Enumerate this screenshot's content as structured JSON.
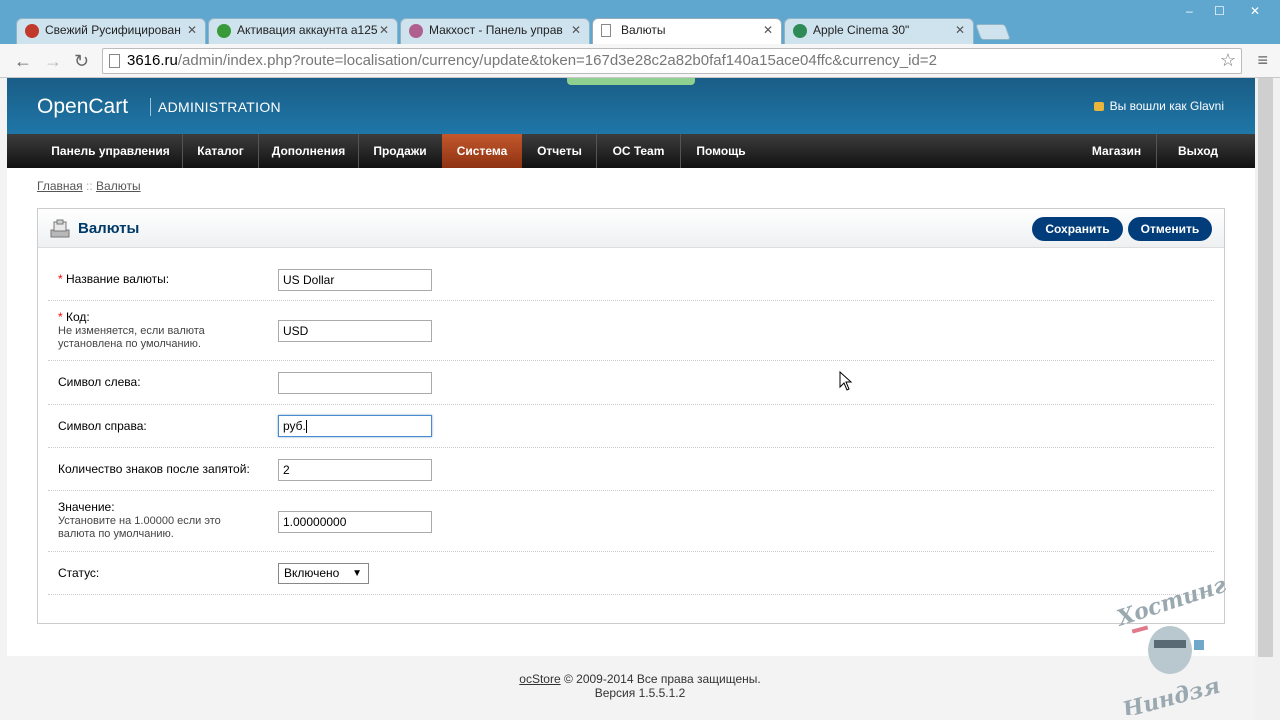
{
  "browser": {
    "tabs": [
      {
        "title": "Свежий Русифицирован",
        "icon_color": "#c0392b",
        "active": false
      },
      {
        "title": "Активация аккаунта a125",
        "icon_color": "#3a9a3a",
        "active": false
      },
      {
        "title": "Макхост - Панель управ",
        "icon_color": "#b06090",
        "active": false
      },
      {
        "title": "Валюты",
        "icon_color": "#ffffff",
        "active": true
      },
      {
        "title": "Apple Cinema 30\"",
        "icon_color": "#2e8b57",
        "active": false
      }
    ],
    "close_glyph": "✕",
    "window_controls": [
      "–",
      "☐",
      "✕"
    ],
    "url_host": "3616.ru",
    "url_path": "/admin/index.php?route=localisation/currency/update&token=167d3e28c2a82b0faf140a15ace04ffc&currency_id=2",
    "back_glyph": "←",
    "forward_glyph": "→",
    "reload_glyph": "↻",
    "star_glyph": "☆",
    "menu_glyph": "≡"
  },
  "header": {
    "logo": "OpenCart",
    "subtitle": "ADMINISTRATION",
    "login_text": "Вы вошли как Glavni"
  },
  "menu": {
    "items": [
      "Панель управления",
      "Каталог",
      "Дополнения",
      "Продажи",
      "Система",
      "Отчеты",
      "OC Team",
      "Помощь"
    ],
    "right_items": [
      "Магазин",
      "Выход"
    ],
    "active": "Система"
  },
  "breadcrumb": {
    "home": "Главная",
    "separator": "::",
    "current": "Валюты"
  },
  "panel": {
    "title": "Валюты",
    "save_label": "Сохранить",
    "cancel_label": "Отменить"
  },
  "form": {
    "required_mark": "*",
    "name_label": "Название валюты:",
    "name_value": "US Dollar",
    "code_label": "Код:",
    "code_help": "Не изменяется, если валюта установлена по умолчанию.",
    "code_value": "USD",
    "symbol_left_label": "Символ слева:",
    "symbol_left_value": "",
    "symbol_right_label": "Символ справа:",
    "symbol_right_value": "руб.",
    "decimal_label": "Количество знаков после запятой:",
    "decimal_value": "2",
    "value_label": "Значение:",
    "value_help": "Установите на 1.00000 если это валюта по умолчанию.",
    "value_value": "1.00000000",
    "status_label": "Статус:",
    "status_value": "Включено"
  },
  "footer": {
    "brand": "ocStore",
    "copyright": "© 2009-2014 Все права защищены.",
    "version": "Версия 1.5.5.1.2"
  },
  "watermark": {
    "text_top": "Хостинг",
    "text_bottom": "Ниндзя"
  }
}
